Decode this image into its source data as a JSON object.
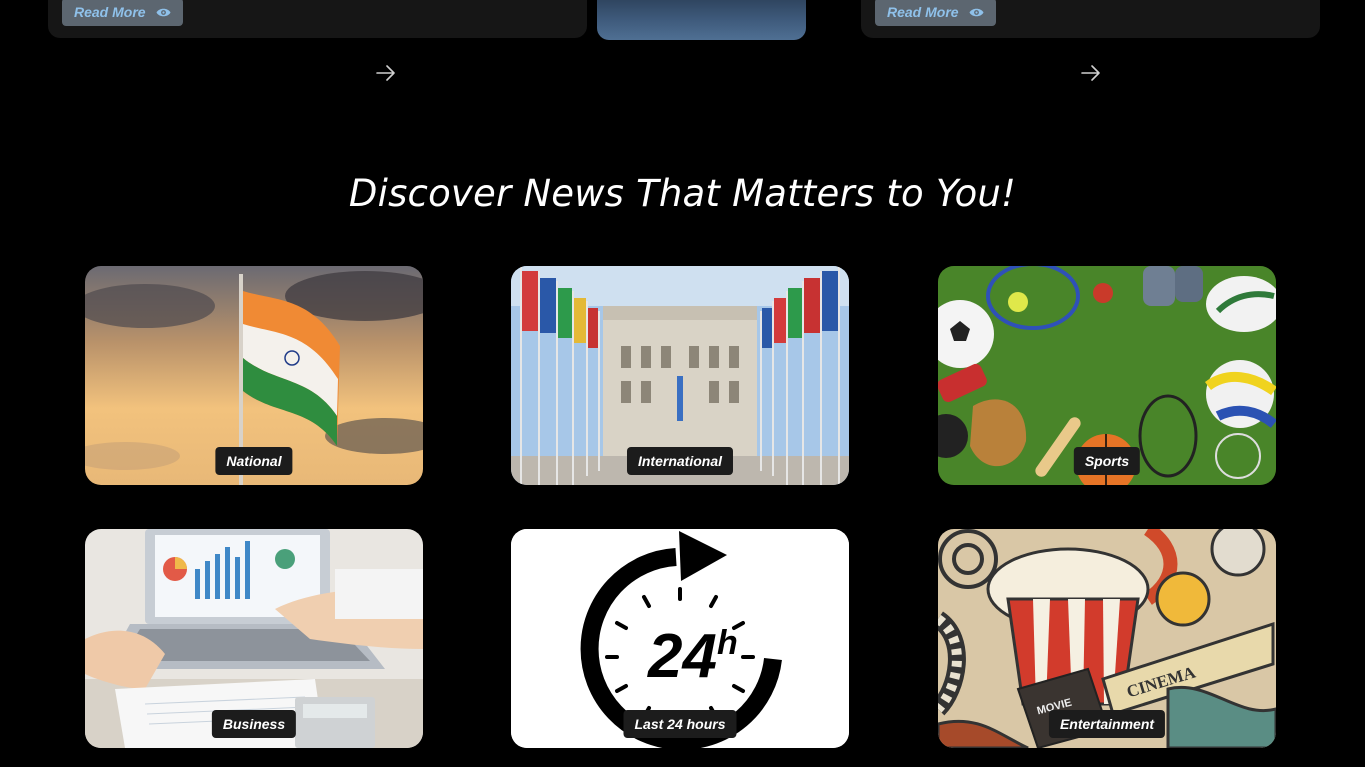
{
  "top_row": {
    "read_more_label": "Read More",
    "eye_icon": "eye-icon",
    "arrow_icon": "arrow-right-icon"
  },
  "headline": "Discover News That Matters to You!",
  "categories": [
    {
      "label": "National",
      "image": "indian-flag-sunset"
    },
    {
      "label": "International",
      "image": "united-nations-flags"
    },
    {
      "label": "Sports",
      "image": "sports-equipment-on-grass"
    },
    {
      "label": "Business",
      "image": "business-charts-laptop"
    },
    {
      "label": "Last 24 hours",
      "image": "24-hours-clock",
      "icon_text": "24",
      "icon_suffix": "h"
    },
    {
      "label": "Entertainment",
      "image": "cinema-popcorn-doodle",
      "icon_text": "CINEMA",
      "icon_sub": "MOVIE"
    }
  ],
  "colors": {
    "background": "#000000",
    "card": "#161616",
    "read_more_text": "#8fc1ea",
    "tag_bg": "#1c1c1c"
  }
}
